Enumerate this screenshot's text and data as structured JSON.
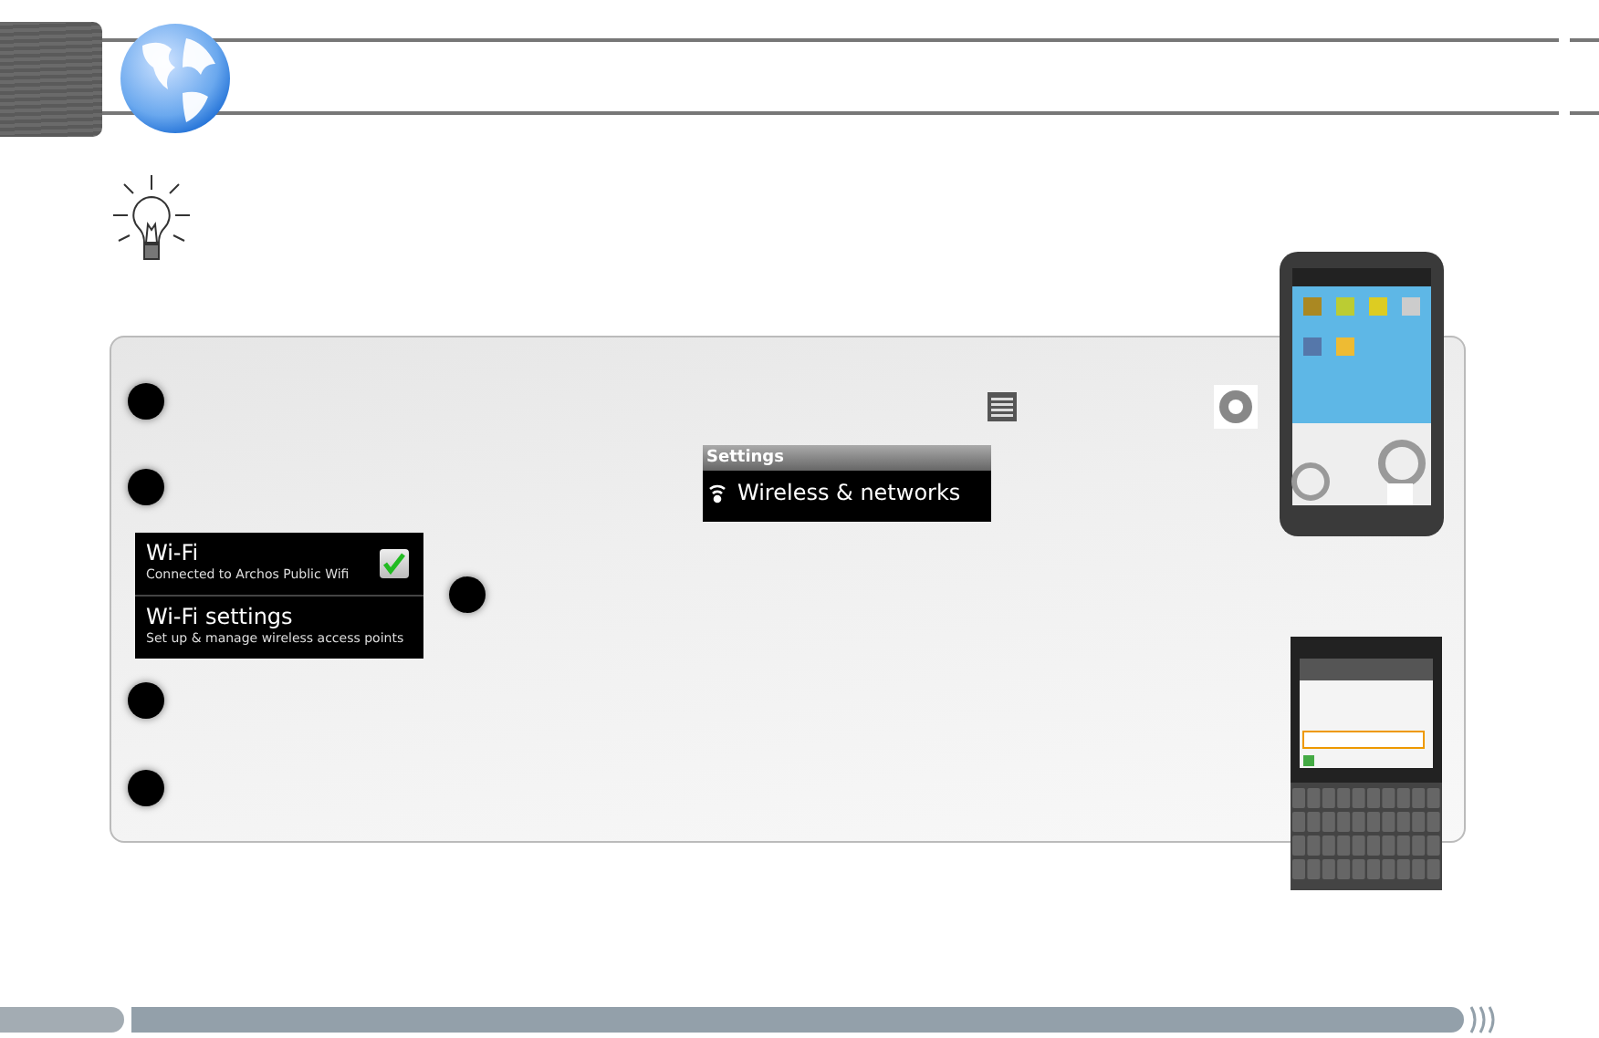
{
  "settings_panel": {
    "title": "Settings",
    "item": "Wireless & networks"
  },
  "wifi_panel": {
    "items": [
      {
        "kind": "toggle",
        "title": "Wi-Fi",
        "subtitle": "Connected to Archos Public Wifi",
        "checked": true
      },
      {
        "kind": "link",
        "title": "Wi-Fi settings",
        "subtitle": "Set up & manage wireless access points"
      }
    ]
  }
}
